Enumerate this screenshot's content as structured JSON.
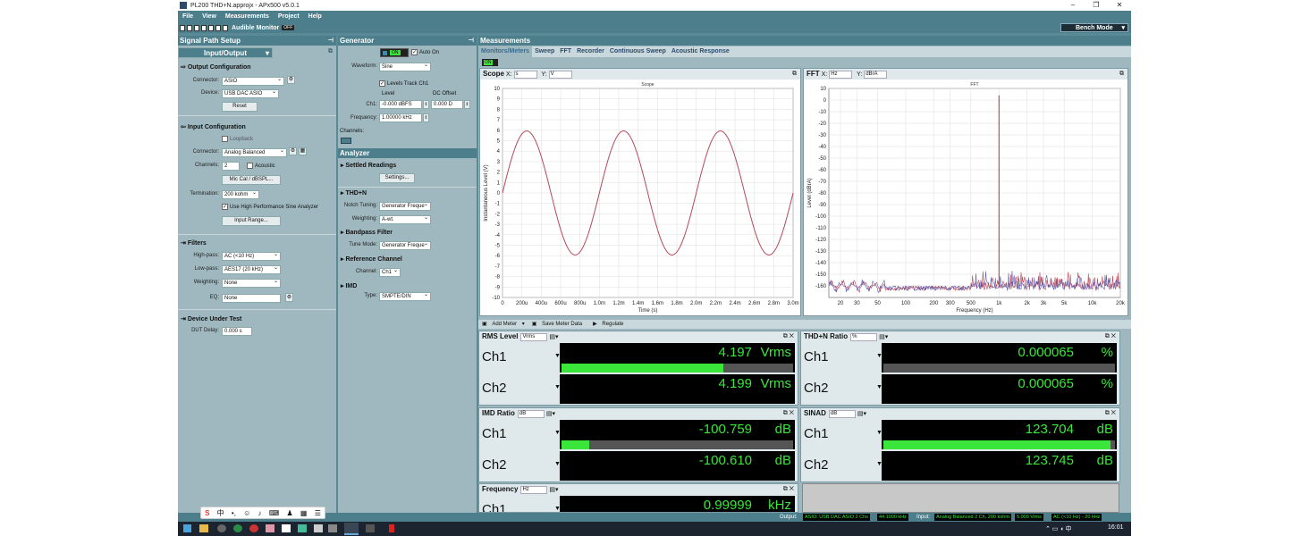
{
  "window": {
    "title": "PL200 THD+N.approjx - APx500 v5.0.1"
  },
  "menu": [
    "File",
    "View",
    "Measurements",
    "Project",
    "Help"
  ],
  "toolbar": {
    "audible_monitor": "Audible Monitor",
    "off": "OFF",
    "bench_mode": "Bench Mode"
  },
  "signal_path": {
    "title": "Signal Path Setup",
    "step": "Input/Output",
    "output_config": "Output Configuration",
    "connector_label": "Connector:",
    "connector_value": "ASIO",
    "device_label": "Device:",
    "device_value": "USB DAC ASIO",
    "reset": "Reset",
    "input_config": "Input Configuration",
    "loopback": "Loopback",
    "in_connector_label": "Connector:",
    "in_connector_value": "Analog Balanced",
    "channels_label": "Channels:",
    "channels_value": "2",
    "acoustic": "Acoustic",
    "mic_cal": "Mic Cal / dBSPL...",
    "termination_label": "Termination:",
    "termination_value": "200 kohm",
    "high_perf": "Use High Performance Sine Analyzer",
    "input_range": "Input Range...",
    "filters": "Filters",
    "highpass_label": "High-pass:",
    "highpass_value": "AC (<10 Hz)",
    "lowpass_label": "Low-pass:",
    "lowpass_value": "AES17 (20 kHz)",
    "weighting_label": "Weighting:",
    "weighting_value": "None",
    "eq_label": "EQ:",
    "eq_value": "None",
    "dut": "Device Under Test",
    "dut_delay_label": "DUT Delay:",
    "dut_delay_value": "0.000 s"
  },
  "generator": {
    "title": "Generator",
    "on": "ON",
    "auto_on": "Auto On",
    "waveform_label": "Waveform:",
    "waveform_value": "Sine",
    "levels_track": "Levels Track Ch1",
    "level_head": "Level",
    "dc_head": "DC Offset",
    "ch1_label": "Ch1:",
    "ch1_level": "-0.000 dBFS",
    "ch1_dc": "0.000 D",
    "frequency_label": "Frequency:",
    "frequency_value": "1.00000 kHz",
    "channels_label": "Channels:"
  },
  "analyzer": {
    "title": "Analyzer",
    "settled": "Settled Readings",
    "settings": "Settings...",
    "thdn": "THD+N",
    "notch_label": "Notch Tuning:",
    "notch_value": "Generator Freque",
    "weighting_label": "Weighting:",
    "weighting_value": "A-wt.",
    "bandpass": "Bandpass Filter",
    "tune_label": "Tune Mode:",
    "tune_value": "Generator Freque",
    "reference": "Reference Channel",
    "ref_ch_label": "Channel:",
    "ref_ch_value": "Ch1",
    "imd": "IMD",
    "imd_type_label": "Type:",
    "imd_type_value": "SMPTE/DIN"
  },
  "measurements": {
    "title": "Measurements",
    "tabs": [
      "Monitors/Meters",
      "Sweep",
      "FFT",
      "Recorder",
      "Continuous Sweep",
      "Acoustic Response"
    ],
    "on": "ON",
    "add_meter": "Add Meter",
    "save_meter": "Save Meter Data",
    "regulate": "Regulate"
  },
  "scope": {
    "name": "Scope",
    "x_label": "X:",
    "x_unit": "s",
    "y_label": "Y:",
    "y_unit": "V",
    "plot_title": "Scope",
    "xlabel": "Time (s)",
    "ylabel": "Instantaneous Level (V)"
  },
  "fft": {
    "name": "FFT",
    "x_label": "X:",
    "x_unit": "Hz",
    "y_label": "Y:",
    "y_unit": "dBrA",
    "plot_title": "FFT",
    "xlabel": "Frequency (Hz)",
    "ylabel": "Level (dBrA)"
  },
  "chart_data": [
    {
      "type": "line",
      "title": "Scope",
      "xlabel": "Time (s)",
      "ylabel": "Instantaneous Level (V)",
      "xlim": [
        0,
        0.003
      ],
      "ylim": [
        -10,
        10
      ],
      "x_ticks": [
        "0",
        "200u",
        "400u",
        "600u",
        "800u",
        "1.0m",
        "1.2m",
        "1.4m",
        "1.6m",
        "1.8m",
        "2.0m",
        "2.2m",
        "2.4m",
        "2.6m",
        "2.8m",
        "3.0m"
      ],
      "y_ticks": [
        "10",
        "9",
        "8",
        "7",
        "6",
        "5",
        "4",
        "3",
        "2",
        "1",
        "0",
        "-1",
        "-2",
        "-3",
        "-4",
        "-5",
        "-6",
        "-7",
        "-8",
        "-9",
        "-10"
      ],
      "series": [
        {
          "amplitude": 5.93,
          "frequency_hz": 1000,
          "color": "#b34a5a"
        }
      ],
      "grid": true
    },
    {
      "type": "line",
      "title": "FFT",
      "xlabel": "Frequency (Hz)",
      "ylabel": "Level (dBrA)",
      "xlim": [
        15,
        20000
      ],
      "ylim": [
        -170,
        10
      ],
      "x_scale": "log",
      "x_ticks": [
        "20",
        "30",
        "50",
        "100",
        "200",
        "300",
        "500",
        "1k",
        "2k",
        "3k",
        "5k",
        "10k",
        "20k"
      ],
      "x_tick_values": [
        20,
        30,
        50,
        100,
        200,
        300,
        500,
        1000,
        2000,
        3000,
        5000,
        10000,
        20000
      ],
      "y_ticks": [
        "10",
        "0",
        "-10",
        "-20",
        "-30",
        "-40",
        "-50",
        "-60",
        "-70",
        "-80",
        "-90",
        "-100",
        "-110",
        "-120",
        "-130",
        "-140",
        "-150",
        "-160"
      ],
      "peak": {
        "frequency_hz": 1000,
        "level": 4
      },
      "noise_floor": -160,
      "series": [
        {
          "color": "#b03040"
        },
        {
          "color": "#4a4aa8"
        }
      ],
      "grid": true
    }
  ],
  "meters": [
    {
      "title": "RMS Level",
      "unit_select": "Vrms",
      "rows": [
        {
          "ch": "Ch1",
          "value": "4.197",
          "unit": "Vrms",
          "bar1": 0.7,
          "bar2": 0.7
        },
        {
          "ch": "Ch2",
          "value": "4.199",
          "unit": "Vrms",
          "bar1": 0.7,
          "bar2": 0.7
        }
      ]
    },
    {
      "title": "THD+N Ratio",
      "unit_select": "%",
      "rows": [
        {
          "ch": "Ch1",
          "value": "0.000065",
          "unit": "%",
          "bar1": 0.0,
          "bar2": 0.0
        },
        {
          "ch": "Ch2",
          "value": "0.000065",
          "unit": "%",
          "bar1": 0.0,
          "bar2": 0.0
        }
      ]
    },
    {
      "title": "IMD Ratio",
      "unit_select": "dB",
      "rows": [
        {
          "ch": "Ch1",
          "value": "-100.759",
          "unit": "dB",
          "bar1": 0.12,
          "bar2": 0.12
        },
        {
          "ch": "Ch2",
          "value": "-100.610",
          "unit": "dB",
          "bar1": 0.12,
          "bar2": 0.12
        }
      ]
    },
    {
      "title": "SINAD",
      "unit_select": "dB",
      "rows": [
        {
          "ch": "Ch1",
          "value": "123.704",
          "unit": "dB",
          "bar1": 0.98,
          "bar2": 0.98
        },
        {
          "ch": "Ch2",
          "value": "123.745",
          "unit": "dB",
          "bar1": 0.98,
          "bar2": 0.98
        }
      ]
    },
    {
      "title": "Frequency",
      "unit_select": "Hz",
      "rows": [
        {
          "ch": "Ch1",
          "value": "0.99999",
          "unit": "kHz",
          "bar1": 0.5,
          "bar2": 0.5
        }
      ]
    }
  ],
  "status": {
    "output_label": "Output:",
    "output_device": "ASIO: USB DAC ASIO 2 Chs",
    "output_rate": "44.1000 kHz",
    "input_label": "Input:",
    "input_device": "Analog Balanced 2 Ch, 200 kohm",
    "input_level": "5.000 Vrms",
    "input_filter": "AC (<10 Hz) - 20 kHz"
  },
  "taskbar": {
    "time": "16:01",
    "ime": "中"
  },
  "colors": {
    "accent": "#4d7e8b",
    "panel": "#9fb8bf",
    "meter_green": "#39e639",
    "scope_trace": "#b34a5a"
  }
}
